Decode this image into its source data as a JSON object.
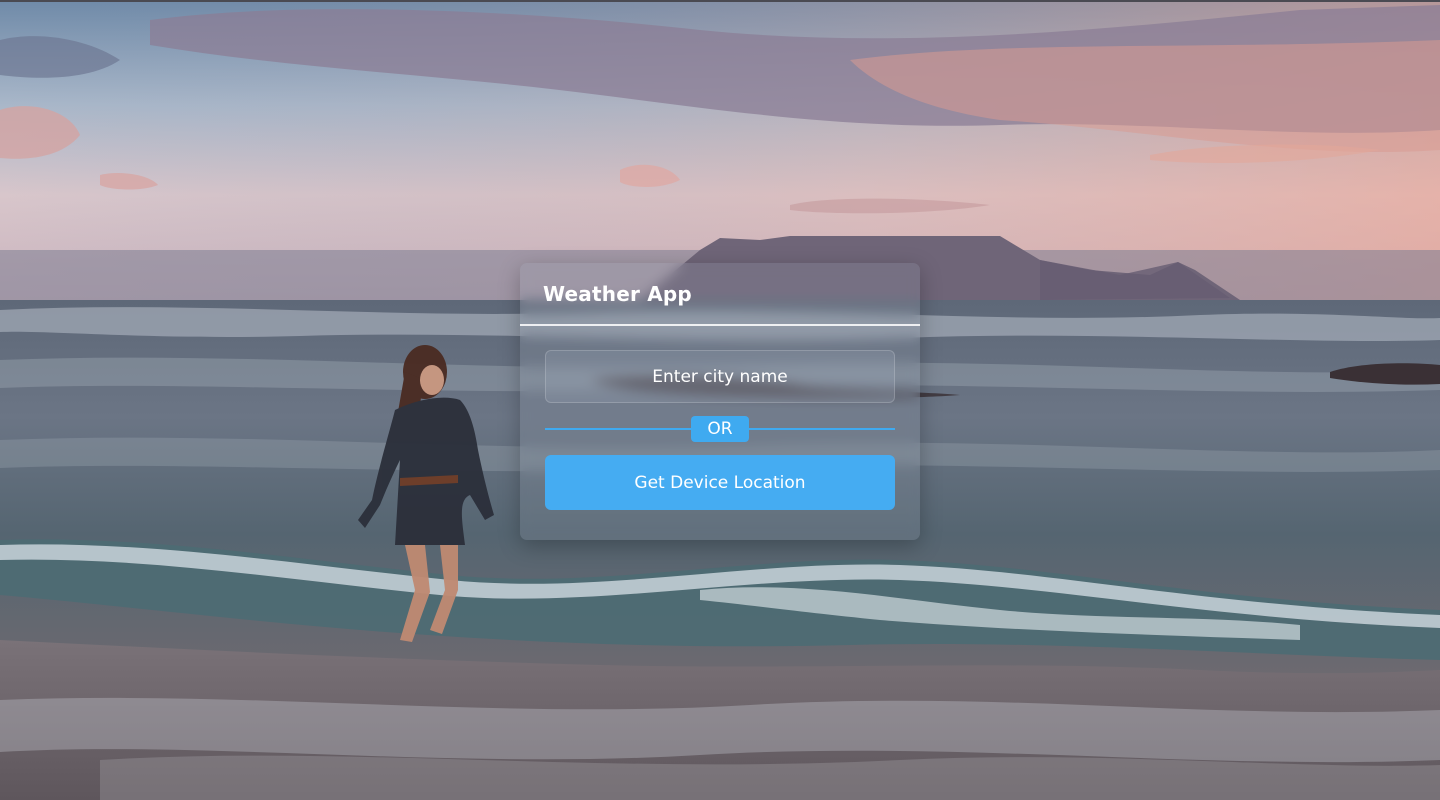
{
  "app": {
    "title": "Weather App"
  },
  "search": {
    "placeholder": "Enter city name",
    "value": ""
  },
  "divider": {
    "label": "OR"
  },
  "location_button": {
    "label": "Get Device Location"
  },
  "colors": {
    "accent": "#45acf2",
    "divider_line": "#3faaf0",
    "text": "#ffffff"
  }
}
